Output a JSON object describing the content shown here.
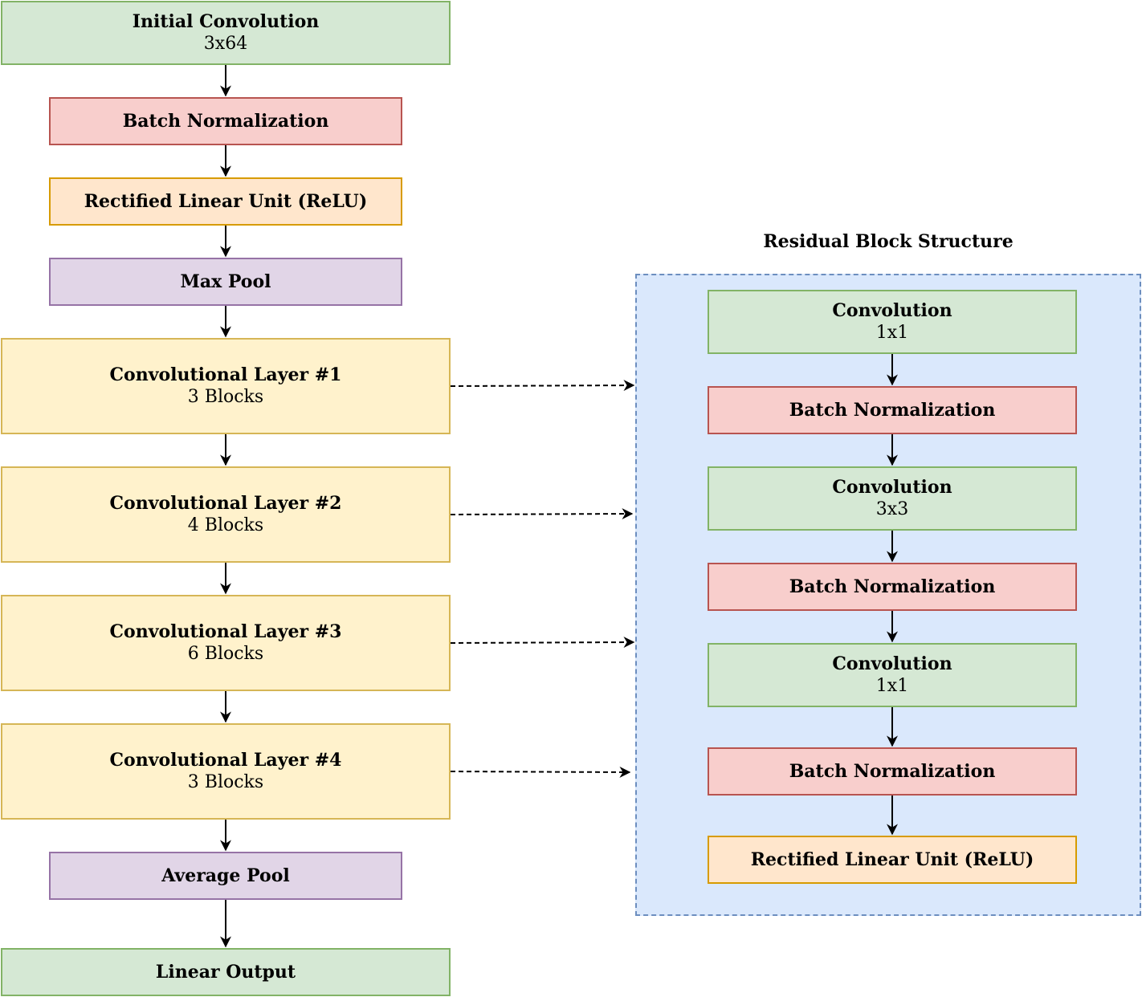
{
  "main_flow": [
    {
      "title": "Initial Convolution",
      "subtitle": "3x64"
    },
    {
      "title": "Batch Normalization"
    },
    {
      "title": "Rectified Linear Unit (ReLU)"
    },
    {
      "title": "Max Pool"
    },
    {
      "title": "Convolutional Layer #1",
      "subtitle": "3 Blocks"
    },
    {
      "title": "Convolutional Layer #2",
      "subtitle": "4 Blocks"
    },
    {
      "title": "Convolutional Layer #3",
      "subtitle": "6 Blocks"
    },
    {
      "title": "Convolutional Layer #4",
      "subtitle": "3 Blocks"
    },
    {
      "title": "Average Pool"
    },
    {
      "title": "Linear Output"
    }
  ],
  "residual_block": {
    "heading": "Residual Block Structure",
    "steps": [
      {
        "title": "Convolution",
        "subtitle": "1x1"
      },
      {
        "title": "Batch Normalization"
      },
      {
        "title": "Convolution",
        "subtitle": "3x3"
      },
      {
        "title": "Batch Normalization"
      },
      {
        "title": "Convolution",
        "subtitle": "1x1"
      },
      {
        "title": "Batch Normalization"
      },
      {
        "title": "Rectified Linear Unit (ReLU)"
      }
    ]
  },
  "colors": {
    "conv_fill": "#d5e8d4",
    "conv_stroke": "#82b366",
    "bn_fill": "#f8cecc",
    "bn_stroke": "#b85450",
    "relu_fill": "#ffe6cc",
    "relu_stroke": "#d79b00",
    "pool_fill": "#e1d5e7",
    "pool_stroke": "#9673a6",
    "layer_fill": "#fff2cc",
    "layer_stroke": "#d6b656",
    "container_fill": "#dae8fc",
    "container_stroke": "#6c8ebf"
  }
}
